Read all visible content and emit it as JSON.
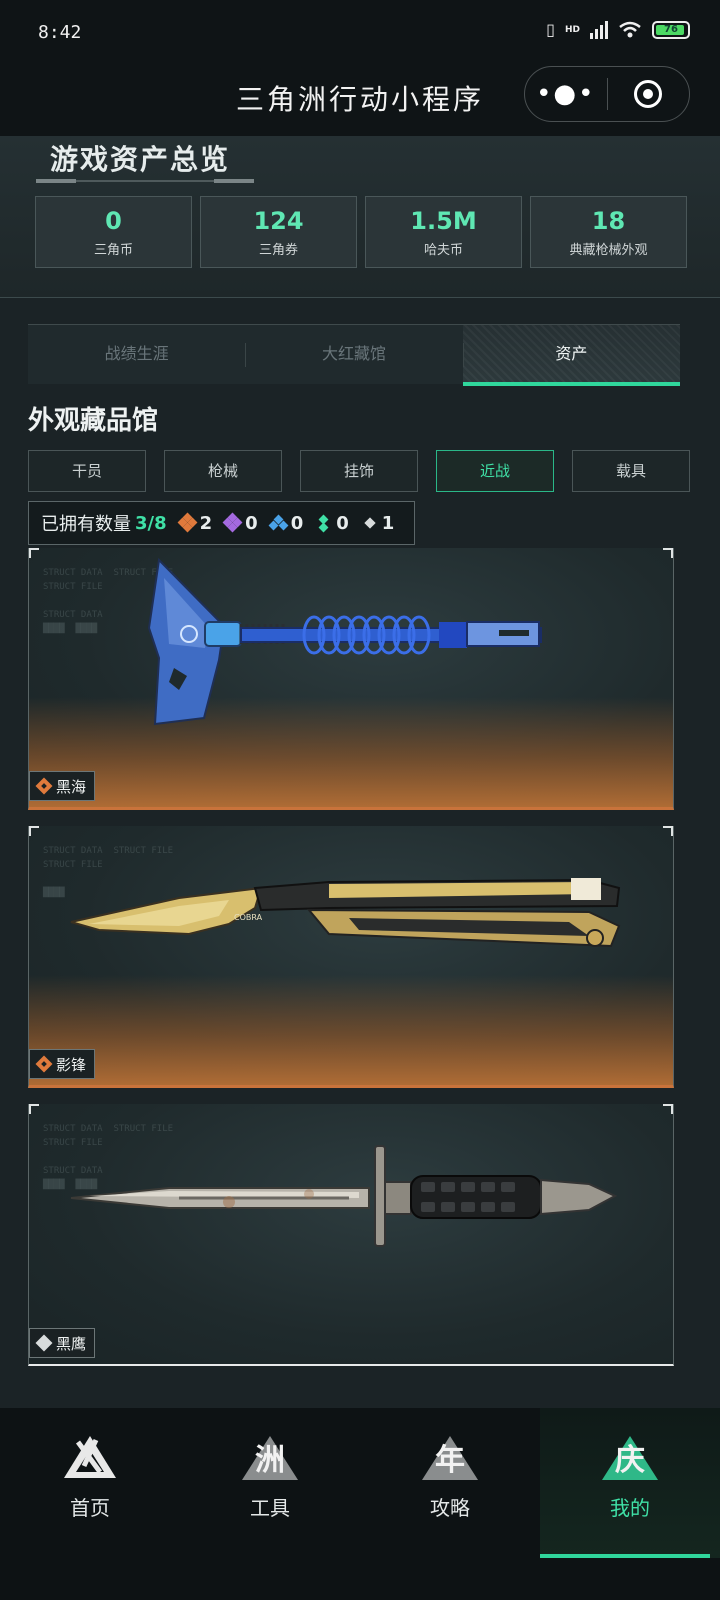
{
  "status_bar": {
    "time": "8:42",
    "battery": "76",
    "network": "HD"
  },
  "nav": {
    "title": "三角洲行动小程序",
    "more_icon": "more-dots-icon",
    "close_icon": "target-icon"
  },
  "overview": {
    "title": "游戏资产总览",
    "stats": [
      {
        "value": "0",
        "label": "三角币"
      },
      {
        "value": "124",
        "label": "三角券"
      },
      {
        "value": "1.5M",
        "label": "哈夫币"
      },
      {
        "value": "18",
        "label": "典藏枪械外观"
      }
    ]
  },
  "tabs": [
    {
      "label": "战绩生涯",
      "active": false
    },
    {
      "label": "大红藏馆",
      "active": false
    },
    {
      "label": "资产",
      "active": true
    }
  ],
  "section": {
    "title": "外观藏品馆",
    "filters": [
      {
        "label": "干员",
        "active": false
      },
      {
        "label": "枪械",
        "active": false
      },
      {
        "label": "挂饰",
        "active": false
      },
      {
        "label": "近战",
        "active": true
      },
      {
        "label": "载具",
        "active": false
      }
    ],
    "owned": {
      "label": "已拥有数量",
      "count": "3/8",
      "rarities": [
        {
          "icon": "orange-diamond-icon",
          "color": "#e07a3c",
          "count": "2"
        },
        {
          "icon": "purple-diamond-icon",
          "color": "#a46ae0",
          "count": "0"
        },
        {
          "icon": "blue-diamond-icon",
          "color": "#4aa3e8",
          "count": "0"
        },
        {
          "icon": "green-diamond-icon",
          "color": "#3fe0a6",
          "count": "0"
        },
        {
          "icon": "white-diamond-icon",
          "color": "#d8dcdc",
          "count": "1"
        }
      ]
    }
  },
  "items": [
    {
      "name": "黑海",
      "rarity": "orange",
      "weapon_icon": "axe-icon"
    },
    {
      "name": "影锋",
      "rarity": "orange",
      "weapon_icon": "butterfly-knife-icon"
    },
    {
      "name": "黑鹰",
      "rarity": "white",
      "weapon_icon": "combat-knife-icon"
    }
  ],
  "bottom_nav": [
    {
      "label": "首页",
      "icon": "home-logo-icon",
      "active": false
    },
    {
      "label": "工具",
      "icon": "tools-logo-icon",
      "active": false
    },
    {
      "label": "攻略",
      "icon": "guide-logo-icon",
      "active": false
    },
    {
      "label": "我的",
      "icon": "profile-logo-icon",
      "active": true
    }
  ],
  "colors": {
    "accent": "#30d79c",
    "accent_text": "#3fe0a6",
    "orange_rarity": "#e07a3c"
  }
}
